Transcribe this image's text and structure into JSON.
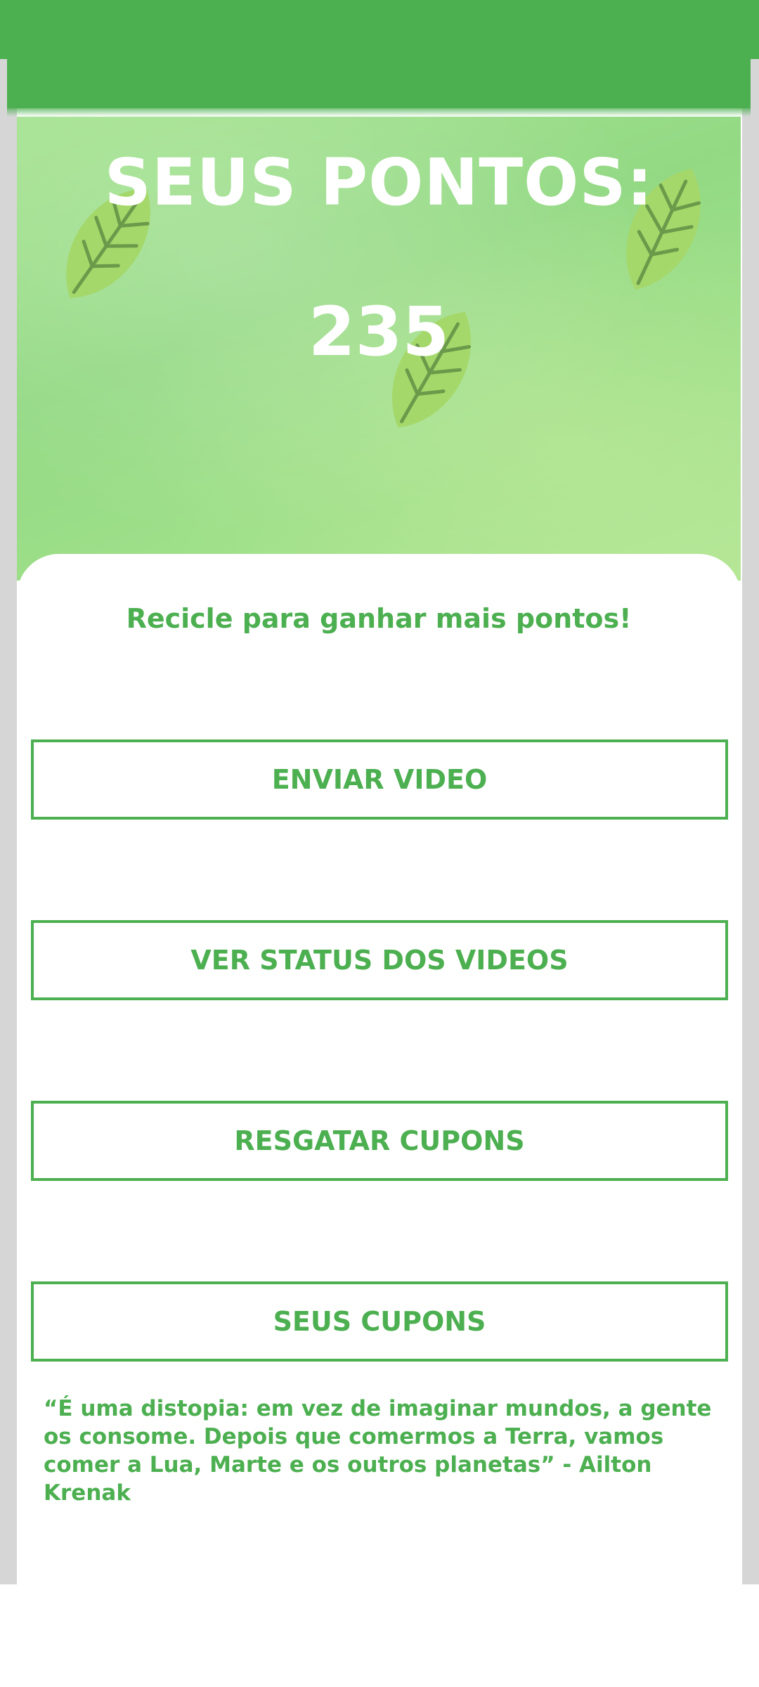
{
  "colors": {
    "primary": "#4caf50",
    "hero_background": "#9fe08a",
    "leaf": "#a5d86a",
    "leaf_vein": "#6a9a4a",
    "rail": "#d6d6d6"
  },
  "hero": {
    "title": "SEUS PONTOS:",
    "points": "235"
  },
  "panel": {
    "subtitle": "Recicle para ganhar mais pontos!",
    "buttons": [
      {
        "label": "ENVIAR VIDEO"
      },
      {
        "label": "VER STATUS DOS VIDEOS"
      },
      {
        "label": "RESGATAR CUPONS"
      },
      {
        "label": "SEUS CUPONS"
      }
    ],
    "quote": "“É uma distopia: em vez de imaginar mundos, a gente os consome. Depois que comermos a Terra, vamos comer a Lua, Marte e os outros planetas” - Ailton Krenak"
  }
}
